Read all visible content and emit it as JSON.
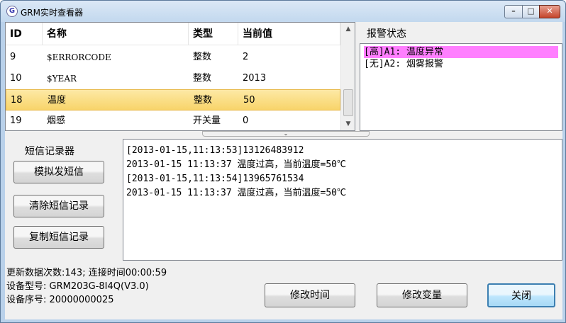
{
  "window": {
    "title": "GRM实时查看器",
    "icon_letter": "G",
    "controls": {
      "minimize": "–",
      "maximize": "□",
      "close": "✕"
    }
  },
  "table": {
    "columns": [
      "ID",
      "名称",
      "类型",
      "当前值"
    ],
    "rows": [
      {
        "id": "9",
        "name": "$ERRORCODE",
        "type": "整数",
        "value": "2"
      },
      {
        "id": "10",
        "name": "$YEAR",
        "type": "整数",
        "value": "2013"
      },
      {
        "id": "18",
        "name": "温度",
        "type": "整数",
        "value": "50"
      },
      {
        "id": "19",
        "name": "烟感",
        "type": "开关量",
        "value": "0"
      }
    ],
    "selected_row": 2,
    "scroll_up": "▲",
    "scroll_down": "▼"
  },
  "alarm": {
    "label": "报警状态",
    "items": [
      "[高]A1: 温度异常",
      "[无]A2: 烟雾报警"
    ]
  },
  "splitter": {
    "glyph": "⌄"
  },
  "sms": {
    "label": "短信记录器",
    "buttons": {
      "simulate": "模拟发短信",
      "clear": "清除短信记录",
      "copy": "复制短信记录"
    },
    "log": [
      "[2013-01-15,11:13:53]13126483912",
      "2013-01-15 11:13:37 温度过高，当前温度=50℃",
      "[2013-01-15,11:13:54]13965761534",
      "2013-01-15 11:13:37 温度过高，当前温度=50℃"
    ]
  },
  "status": {
    "update_line": "更新数据次数:143; 连接时间00:00:59",
    "model_line": "设备型号: GRM203G-8I4Q(V3.0)",
    "serial_line": "设备序号: 20000000025"
  },
  "footer": {
    "modify_time": "修改时间",
    "modify_var": "修改变量",
    "close": "关闭"
  }
}
